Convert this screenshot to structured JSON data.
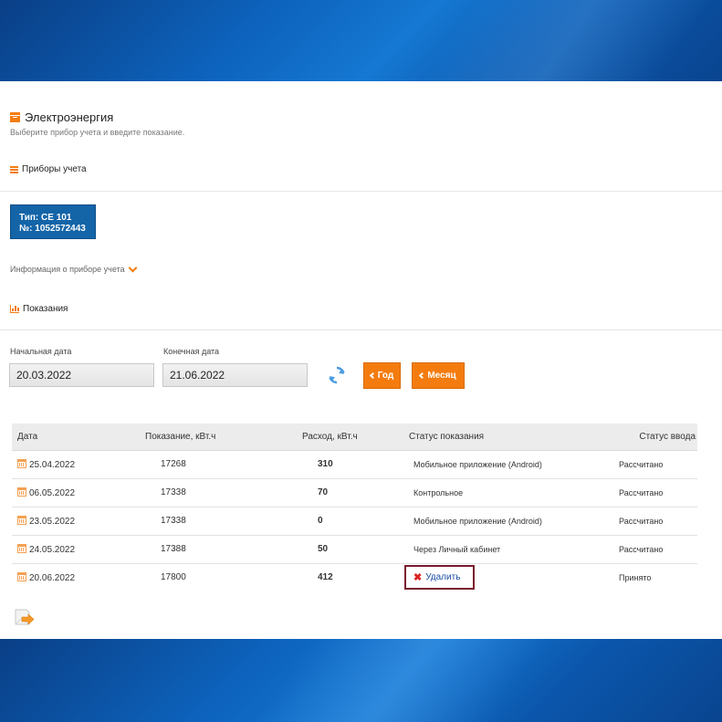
{
  "page": {
    "title": "Электроэнергия",
    "subtitle": "Выберите прибор учета и введите показание."
  },
  "meters": {
    "section_title": "Приборы учета",
    "card": {
      "type_line": "Тип: CE 101",
      "number_line": "№: 1052572443"
    },
    "info_link": "Информация о приборе учета"
  },
  "readings_section": {
    "title": "Показания",
    "start_label": "Начальная дата",
    "start_value": "20.03.2022",
    "end_label": "Конечная дата",
    "end_value": "21.06.2022",
    "year_button": "Год",
    "month_button": "Месяц"
  },
  "table": {
    "headers": [
      "Дата",
      "Показание, кВт.ч",
      "Расход, кВт.ч",
      "Статус показания",
      "Статус ввода"
    ],
    "rows": [
      {
        "date": "25.04.2022",
        "reading": "17268",
        "usage": "310",
        "status": "Мобильное приложение (Android)",
        "input_status": "Рассчитано"
      },
      {
        "date": "06.05.2022",
        "reading": "17338",
        "usage": "70",
        "status": "Контрольное",
        "input_status": "Рассчитано"
      },
      {
        "date": "23.05.2022",
        "reading": "17338",
        "usage": "0",
        "status": "Мобильное приложение (Android)",
        "input_status": "Рассчитано"
      },
      {
        "date": "24.05.2022",
        "reading": "17388",
        "usage": "50",
        "status": "Через Личный кабинет",
        "input_status": "Рассчитано"
      },
      {
        "date": "20.06.2022",
        "reading": "17800",
        "usage": "412",
        "delete_label": "Удалить",
        "input_status": "Принято"
      }
    ]
  },
  "colors": {
    "accent": "#f47c0f",
    "meter_card": "#1464a8",
    "highlight_border": "#7a1a2e",
    "link": "#1b4fa3"
  },
  "icons": [
    "title-box-icon",
    "list-icon",
    "chevron-down-icon",
    "bar-chart-icon",
    "refresh-icon",
    "calendar-icon",
    "delete-x-icon",
    "export-icon"
  ]
}
